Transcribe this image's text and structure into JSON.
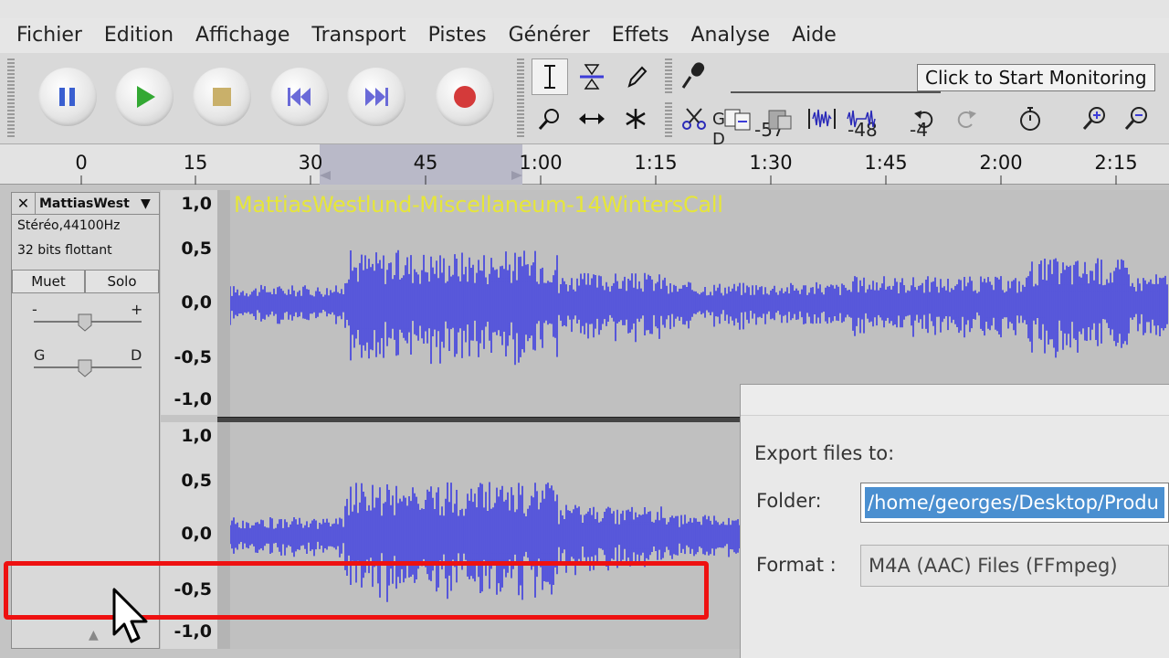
{
  "menu": {
    "items": [
      "Fichier",
      "Edition",
      "Affichage",
      "Transport",
      "Pistes",
      "Générer",
      "Effets",
      "Analyse",
      "Aide"
    ]
  },
  "meter": {
    "g_label": "G",
    "d_label": "D",
    "scale": [
      "-57",
      "-48",
      "-4"
    ],
    "monitor_text": "Click to Start Monitoring"
  },
  "ruler": {
    "labels": [
      "0",
      "15",
      "30",
      "45",
      "1:00",
      "1:15",
      "1:30",
      "1:45",
      "2:00",
      "2:15"
    ]
  },
  "track": {
    "name": "MattiasWest",
    "format_line1": "Stéréo,44100Hz",
    "format_line2": "32 bits flottant",
    "mute_label": "Muet",
    "solo_label": "Solo",
    "gain_minus": "-",
    "gain_plus": "+",
    "pan_left": "G",
    "pan_right": "D",
    "clip_title": "MattiasWestlund-Miscellaneum-14WintersCall",
    "scale_top": [
      "1,0",
      "0,5",
      "0,0",
      "-0,5",
      "-1,0"
    ],
    "scale_bottom": [
      "1,0",
      "0,5",
      "0,0",
      "-0,5",
      "-1,0"
    ]
  },
  "export_dialog": {
    "heading": "Export files to:",
    "folder_label": "Folder:",
    "folder_value": "/home/georges/Desktop/Produ",
    "format_label": "Format :",
    "format_value": "M4A (AAC) Files (FFmpeg)"
  },
  "colors": {
    "waveform": "#3d3de0",
    "clip_title": "#e6e63a",
    "highlight": "#e11111",
    "selection": "#4a8fd0"
  }
}
